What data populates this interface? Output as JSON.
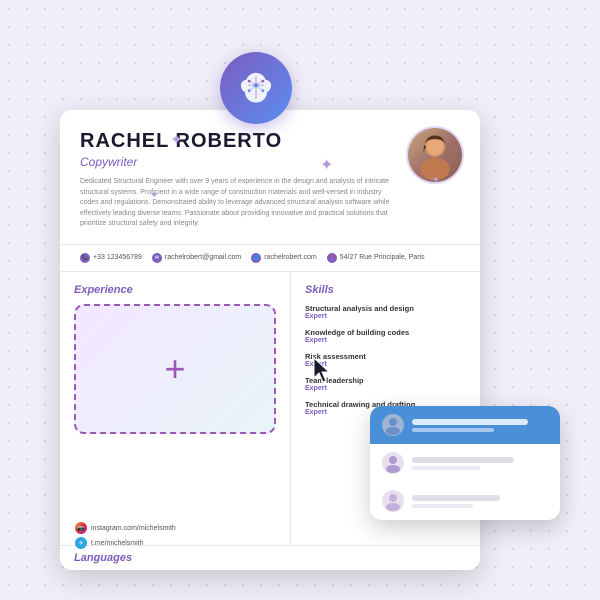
{
  "background": {
    "dotColor": "#b39ddb"
  },
  "brainIcon": {
    "label": "AI Brain Icon"
  },
  "resume": {
    "name": "RACHEL ROBERTO",
    "title": "Copywriter",
    "bio": "Dedicated Structural Engineer with over 9 years of experience in the design and analysis of intricate structural systems. Proficient in a wide range of construction materials and well-versed in industry codes and regulations. Demonstrated ability to leverage advanced structural analysis software while effectively leading diverse teams. Passionate about providing innovative and practical solutions that prioritize structural safety and integrity.",
    "photo_alt": "Rachel Roberto photo",
    "contact": {
      "phone": "+33 123456789",
      "email": "rachelrobert@gmail.com",
      "website": "rachelrobert.com",
      "address": "54/27 Rue Principale, Paris"
    },
    "sections": {
      "experience": {
        "title": "Experience",
        "addButton": "+"
      },
      "skills": {
        "title": "Skills",
        "items": [
          {
            "name": "Structural analysis and design",
            "level": "Expert"
          },
          {
            "name": "Knowledge of building codes",
            "level": "Expert"
          },
          {
            "name": "Risk assessment",
            "level": "Expert"
          },
          {
            "name": "Team leadership",
            "level": "Expert"
          },
          {
            "name": "Technical drawing and drafting",
            "level": "Expert"
          }
        ]
      },
      "languages": {
        "title": "Languages"
      }
    }
  },
  "autocomplete": {
    "items": [
      {
        "active": true
      },
      {
        "active": false
      },
      {
        "active": false
      }
    ]
  },
  "social": {
    "instagram": "instagram.com/michelsmith",
    "telegram": "t.me/michelsmith"
  },
  "sparkles": [
    "✦",
    "✦",
    "✦",
    "✦"
  ]
}
